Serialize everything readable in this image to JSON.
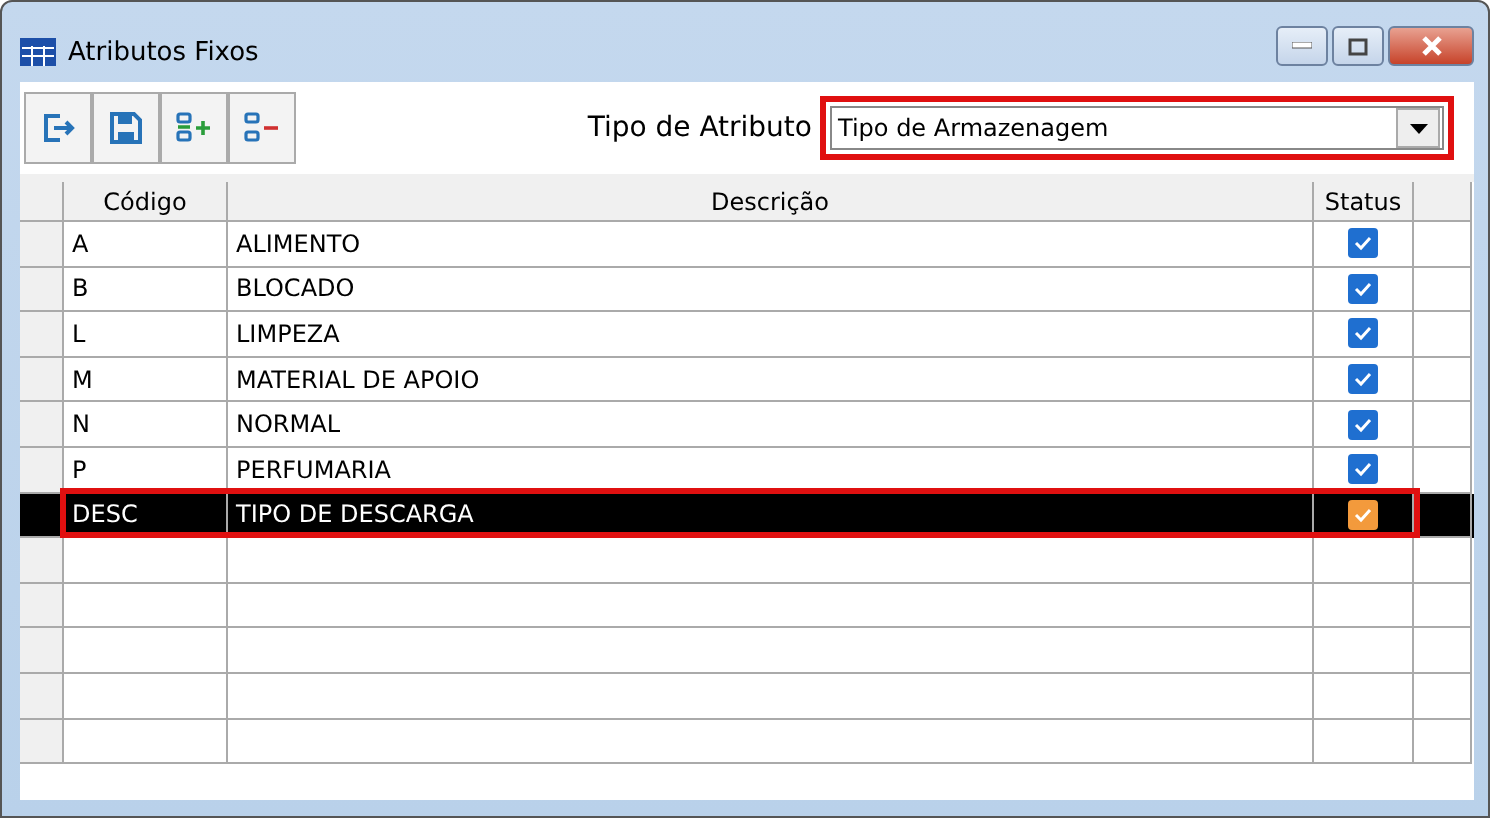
{
  "window": {
    "title": "Atributos Fixos"
  },
  "toolbar": {
    "buttons": [
      {
        "kind": "exit"
      },
      {
        "kind": "save"
      },
      {
        "kind": "add"
      },
      {
        "kind": "remove"
      }
    ]
  },
  "filter": {
    "label": "Tipo de Atributo",
    "value": "Tipo de Armazenagem",
    "annotated": true
  },
  "table": {
    "columns": [
      "Código",
      "Descrição",
      "Status"
    ],
    "rows": [
      {
        "code": "A",
        "description": "ALIMENTO",
        "checked": true,
        "selected": false,
        "annotated": false
      },
      {
        "code": "B",
        "description": "BLOCADO",
        "checked": true,
        "selected": false,
        "annotated": false
      },
      {
        "code": "L",
        "description": "LIMPEZA",
        "checked": true,
        "selected": false,
        "annotated": false
      },
      {
        "code": "M",
        "description": "MATERIAL DE APOIO",
        "checked": true,
        "selected": false,
        "annotated": false
      },
      {
        "code": "N",
        "description": "NORMAL",
        "checked": true,
        "selected": false,
        "annotated": false
      },
      {
        "code": "P",
        "description": "PERFUMARIA",
        "checked": true,
        "selected": false,
        "annotated": false
      },
      {
        "code": "DESC",
        "description": "TIPO DE DESCARGA",
        "checked": true,
        "selected": true,
        "annotated": true
      }
    ]
  }
}
